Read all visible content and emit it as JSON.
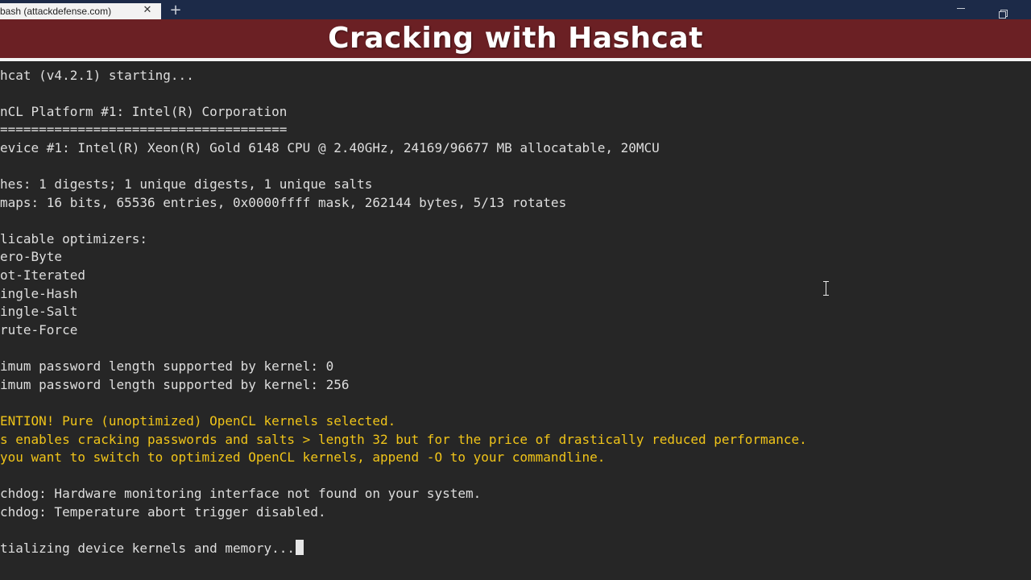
{
  "browser": {
    "tab_title": "bash (attackdefense.com)",
    "tab_close_glyph": "✕",
    "new_tab_glyph": "+"
  },
  "banner": {
    "title": "Cracking with Hashcat",
    "background": "#6b2024"
  },
  "terminal": {
    "text_color": "#dedede",
    "warning_color": "#f0c419",
    "lines": [
      "hcat (v4.2.1) starting...",
      "",
      "nCL Platform #1: Intel(R) Corporation",
      "=====================================",
      "evice #1: Intel(R) Xeon(R) Gold 6148 CPU @ 2.40GHz, 24169/96677 MB allocatable, 20MCU",
      "",
      "hes: 1 digests; 1 unique digests, 1 unique salts",
      "maps: 16 bits, 65536 entries, 0x0000ffff mask, 262144 bytes, 5/13 rotates",
      "",
      "licable optimizers:",
      "ero-Byte",
      "ot-Iterated",
      "ingle-Hash",
      "ingle-Salt",
      "rute-Force",
      "",
      "imum password length supported by kernel: 0",
      "imum password length supported by kernel: 256",
      "",
      "ENTION! Pure (unoptimized) OpenCL kernels selected.",
      "s enables cracking passwords and salts > length 32 but for the price of drastically reduced performance.",
      "you want to switch to optimized OpenCL kernels, append -O to your commandline.",
      "",
      "chdog: Hardware monitoring interface not found on your system.",
      "chdog: Temperature abort trigger disabled.",
      "",
      "tializing device kernels and memory..."
    ]
  }
}
